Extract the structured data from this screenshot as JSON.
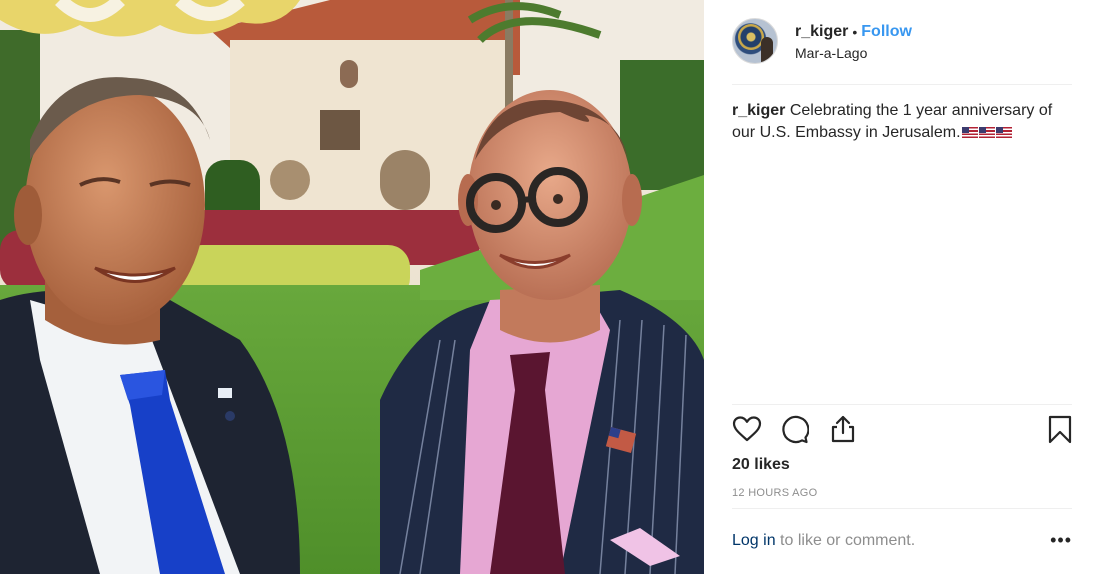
{
  "post": {
    "username": "r_kiger",
    "separator": "•",
    "follow_label": "Follow",
    "location": "Mar-a-Lago",
    "caption_user": "r_kiger",
    "caption_text": "Celebrating the 1 year anniversary of our U.S. Embassy in Jerusalem.",
    "caption_emoji_count": 3,
    "likes": "20 likes",
    "timestamp": "12 HOURS AGO",
    "login_label": "Log in",
    "comment_prompt": " to like or comment.",
    "more_label": "•••"
  },
  "icons": {
    "like": "heart-icon",
    "comment": "comment-icon",
    "share": "share-icon",
    "save": "bookmark-icon",
    "flag": "us-flag-icon"
  },
  "colors": {
    "link": "#3897f0",
    "login": "#003569",
    "muted": "#8e8e8e",
    "text": "#262626"
  }
}
